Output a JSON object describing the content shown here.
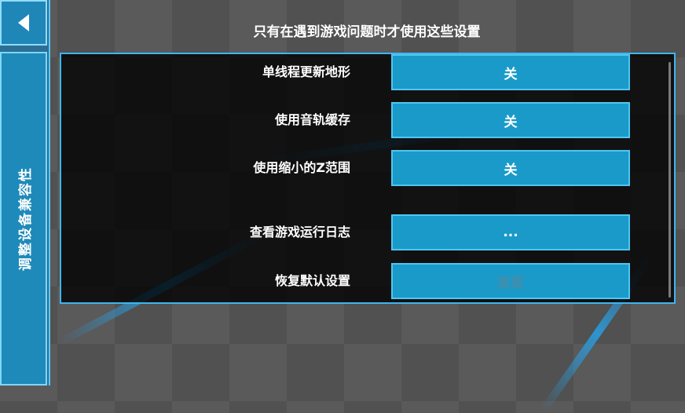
{
  "back": {
    "icon": "back-arrow-icon"
  },
  "sidebar": {
    "tab_label": "调整设备兼容性"
  },
  "header": {
    "title": "只有在遇到游戏问题时才使用这些设置"
  },
  "settings": [
    {
      "label": "单线程更新地形",
      "value": "关",
      "enabled": true
    },
    {
      "label": "使用音轨缓存",
      "value": "关",
      "enabled": true
    },
    {
      "label": "使用缩小的Z范围",
      "value": "关",
      "enabled": true
    },
    {
      "label": "查看游戏运行日志",
      "value": "...",
      "enabled": true
    },
    {
      "label": "恢复默认设置",
      "value": "重置",
      "enabled": false
    }
  ],
  "colors": {
    "accent": "#1a9ac9",
    "border": "#4fc6f2",
    "sidebar": "#1e8ab9"
  }
}
